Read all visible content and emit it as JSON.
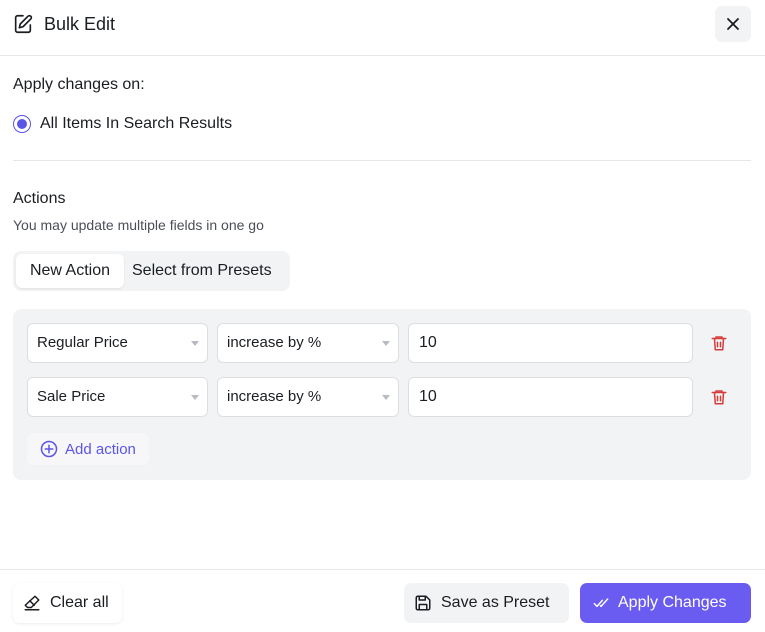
{
  "header": {
    "title": "Bulk Edit",
    "title_icon": "edit-document-icon",
    "close_icon": "close-icon"
  },
  "apply_on": {
    "label": "Apply changes on:",
    "options": [
      {
        "label": "All Items In Search Results",
        "selected": true
      }
    ]
  },
  "actions_section": {
    "title": "Actions",
    "subtitle": "You may update multiple fields in one go"
  },
  "tabs": [
    {
      "label": "New Action",
      "active": true
    },
    {
      "label": "Select from Presets",
      "active": false
    }
  ],
  "action_rows": [
    {
      "field": "Regular Price",
      "operation": "increase by %",
      "value": "10"
    },
    {
      "field": "Sale Price",
      "operation": "increase by %",
      "value": "10"
    }
  ],
  "add_action_label": "Add action",
  "footer": {
    "clear_label": "Clear all",
    "save_preset_label": "Save as Preset",
    "apply_label": "Apply Changes"
  },
  "colors": {
    "accent": "#5b54e8",
    "apply_button": "#6a5cf0",
    "delete_icon": "#d63b3b",
    "panel_bg": "#f2f3f5"
  }
}
